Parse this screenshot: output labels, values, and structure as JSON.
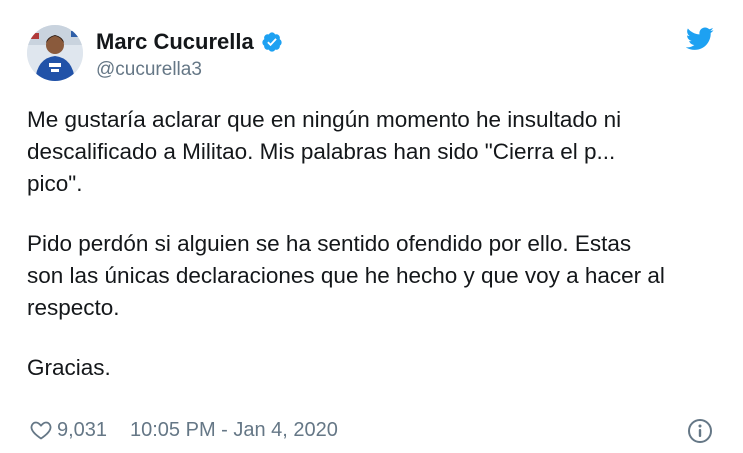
{
  "author": {
    "name": "Marc Cucurella",
    "handle": "@cucurella3",
    "verified_icon": "verified-badge-icon",
    "avatar_icon": "avatar"
  },
  "brand": {
    "icon": "twitter-bird-icon",
    "color": "#1da1f2"
  },
  "tweet": {
    "paragraphs": [
      "Me gustaría aclarar que en ningún momento he insultado ni\ndescalificado a Militao. Mis palabras han sido \"Cierra el p...\npico\".",
      "Pido perdón si alguien se ha sentido ofendido por ello. Estas\nson las únicas declaraciones que he hecho y que voy a hacer al\nrespecto.",
      "Gracias."
    ]
  },
  "footer": {
    "like_icon": "heart-icon",
    "like_count": "9,031",
    "timestamp": "10:05 PM - Jan 4, 2020",
    "info_icon": "info-icon"
  },
  "colors": {
    "text": "#14171a",
    "muted": "#657786",
    "accent": "#1da1f2"
  }
}
